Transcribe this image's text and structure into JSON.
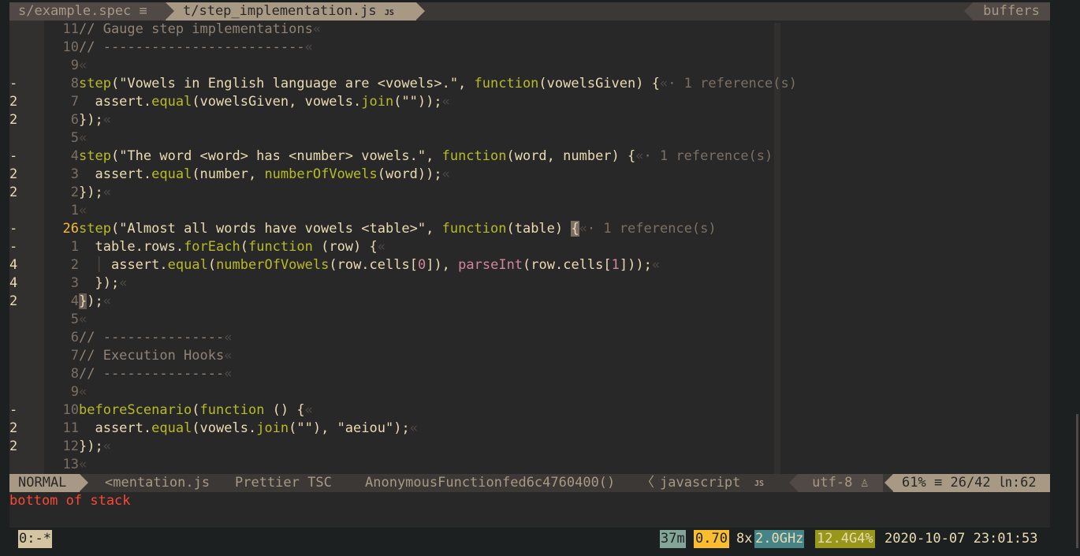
{
  "tabline": {
    "tabs": [
      {
        "label": "s/example.spec",
        "icon": "≡"
      },
      {
        "label": "t/step_implementation.js",
        "icon": "JS"
      }
    ],
    "buffers_label": "buffers"
  },
  "editor": {
    "lines": [
      {
        "sign": "",
        "num": "11",
        "code": [
          [
            "c",
            "// Gauge step implementations"
          ],
          [
            "eol",
            "«"
          ]
        ]
      },
      {
        "sign": "",
        "num": "10",
        "code": [
          [
            "c",
            "// -------------------------"
          ],
          [
            "eol",
            "«"
          ]
        ]
      },
      {
        "sign": "",
        "num": "9",
        "code": [
          [
            "eol",
            "«"
          ]
        ]
      },
      {
        "sign": "-",
        "num": "8",
        "code": [
          [
            "fn",
            "step"
          ],
          [
            "pl",
            "(\"Vowels in English language are <vowels>.\", "
          ],
          [
            "fn",
            "function"
          ],
          [
            "pl",
            "(vowelsGiven) {"
          ],
          [
            "eol",
            "«"
          ],
          [
            "ref",
            "· 1 reference(s)"
          ]
        ]
      },
      {
        "sign": "2",
        "num": "7",
        "code": [
          [
            "pl",
            "  assert."
          ],
          [
            "fn",
            "equal"
          ],
          [
            "pl",
            "(vowelsGiven, vowels."
          ],
          [
            "fn",
            "join"
          ],
          [
            "pl",
            "(\"\"));"
          ],
          [
            "eol",
            "«"
          ]
        ]
      },
      {
        "sign": "2",
        "num": "6",
        "code": [
          [
            "pl",
            "});"
          ],
          [
            "eol",
            "«"
          ]
        ]
      },
      {
        "sign": "",
        "num": "5",
        "code": [
          [
            "eol",
            "«"
          ]
        ]
      },
      {
        "sign": "-",
        "num": "4",
        "code": [
          [
            "fn",
            "step"
          ],
          [
            "pl",
            "(\"The word <word> has <number> vowels.\", "
          ],
          [
            "fn",
            "function"
          ],
          [
            "pl",
            "(word, number) {"
          ],
          [
            "eol",
            "«"
          ],
          [
            "ref",
            "· 1 reference(s)"
          ]
        ]
      },
      {
        "sign": "2",
        "num": "3",
        "code": [
          [
            "pl",
            "  assert."
          ],
          [
            "fn",
            "equal"
          ],
          [
            "pl",
            "(number, "
          ],
          [
            "fn",
            "numberOfVowels"
          ],
          [
            "pl",
            "(word));"
          ],
          [
            "eol",
            "«"
          ]
        ]
      },
      {
        "sign": "2",
        "num": "2",
        "code": [
          [
            "pl",
            "});"
          ],
          [
            "eol",
            "«"
          ]
        ]
      },
      {
        "sign": "",
        "num": "1",
        "code": [
          [
            "eol",
            "«"
          ]
        ]
      },
      {
        "sign": "-",
        "num": "26",
        "current": true,
        "code": [
          [
            "fn",
            "step"
          ],
          [
            "pl",
            "(\"Almost all words have vowels <table>\", "
          ],
          [
            "fn",
            "function"
          ],
          [
            "pl",
            "(table) "
          ],
          [
            "cursor",
            "{"
          ],
          [
            "eol",
            "«"
          ],
          [
            "ref",
            "· 1 reference(s)"
          ]
        ]
      },
      {
        "sign": "-",
        "num": "1",
        "code": [
          [
            "pl",
            "  table.rows."
          ],
          [
            "fn",
            "forEach"
          ],
          [
            "pl",
            "("
          ],
          [
            "fn",
            "function"
          ],
          [
            "pl",
            " (row) {"
          ],
          [
            "eol",
            "«"
          ]
        ]
      },
      {
        "sign": "4",
        "num": "2",
        "code": [
          [
            "pl",
            "  "
          ],
          [
            "guide",
            "│"
          ],
          [
            "pl",
            " assert."
          ],
          [
            "fn",
            "equal"
          ],
          [
            "pl",
            "("
          ],
          [
            "fn",
            "numberOfVowels"
          ],
          [
            "pl",
            "(row.cells["
          ],
          [
            "num",
            "0"
          ],
          [
            "pl",
            "]), "
          ],
          [
            "pi",
            "parseInt"
          ],
          [
            "pl",
            "(row.cells["
          ],
          [
            "num",
            "1"
          ],
          [
            "pl",
            "]));"
          ],
          [
            "eol",
            "«"
          ]
        ]
      },
      {
        "sign": "4",
        "num": "3",
        "code": [
          [
            "pl",
            "  });"
          ],
          [
            "eol",
            "«"
          ]
        ]
      },
      {
        "sign": "2",
        "num": "4",
        "code": [
          [
            "match",
            "}"
          ],
          [
            "pl",
            ");"
          ],
          [
            "eol",
            "«"
          ]
        ]
      },
      {
        "sign": "",
        "num": "5",
        "code": [
          [
            "eol",
            "«"
          ]
        ]
      },
      {
        "sign": "",
        "num": "6",
        "code": [
          [
            "c",
            "// ---------------"
          ],
          [
            "eol",
            "«"
          ]
        ]
      },
      {
        "sign": "",
        "num": "7",
        "code": [
          [
            "c",
            "// Execution Hooks"
          ],
          [
            "eol",
            "«"
          ]
        ]
      },
      {
        "sign": "",
        "num": "8",
        "code": [
          [
            "c",
            "// ---------------"
          ],
          [
            "eol",
            "«"
          ]
        ]
      },
      {
        "sign": "",
        "num": "9",
        "code": [
          [
            "eol",
            "«"
          ]
        ]
      },
      {
        "sign": "-",
        "num": "10",
        "code": [
          [
            "fn",
            "beforeScenario"
          ],
          [
            "pl",
            "("
          ],
          [
            "fn",
            "function"
          ],
          [
            "pl",
            " () {"
          ],
          [
            "eol",
            "«"
          ]
        ]
      },
      {
        "sign": "2",
        "num": "11",
        "code": [
          [
            "pl",
            "  assert."
          ],
          [
            "fn",
            "equal"
          ],
          [
            "pl",
            "(vowels."
          ],
          [
            "fn",
            "join"
          ],
          [
            "pl",
            "(\"\"), \"aeiou\");"
          ],
          [
            "eol",
            "«"
          ]
        ]
      },
      {
        "sign": "2",
        "num": "12",
        "code": [
          [
            "pl",
            "});"
          ],
          [
            "eol",
            "«"
          ]
        ]
      },
      {
        "sign": "",
        "num": "13",
        "code": [
          [
            "eol",
            "«"
          ]
        ]
      }
    ]
  },
  "statusline": {
    "mode": "NORMAL",
    "file": "<mentation.js",
    "linters": "Prettier TSC",
    "function": "AnonymousFunctionfed6c4760400()",
    "separator": "〈",
    "filetype": "javascript",
    "filetype_icon": "JS",
    "encoding": "utf-8",
    "os_icon": "♙",
    "percent": "61%",
    "percent_icon": "≡",
    "position": "26/42",
    "col_icon": "㏑",
    "column": ":62"
  },
  "message": "bottom of stack",
  "tmux": {
    "window": "0:-*",
    "uptime": "37m",
    "load": "0.70",
    "cpu_count": "8x",
    "cpu_freq": "2.0GHz",
    "mem": "12.4G4%",
    "datetime": "2020-10-07 23:01:53"
  }
}
